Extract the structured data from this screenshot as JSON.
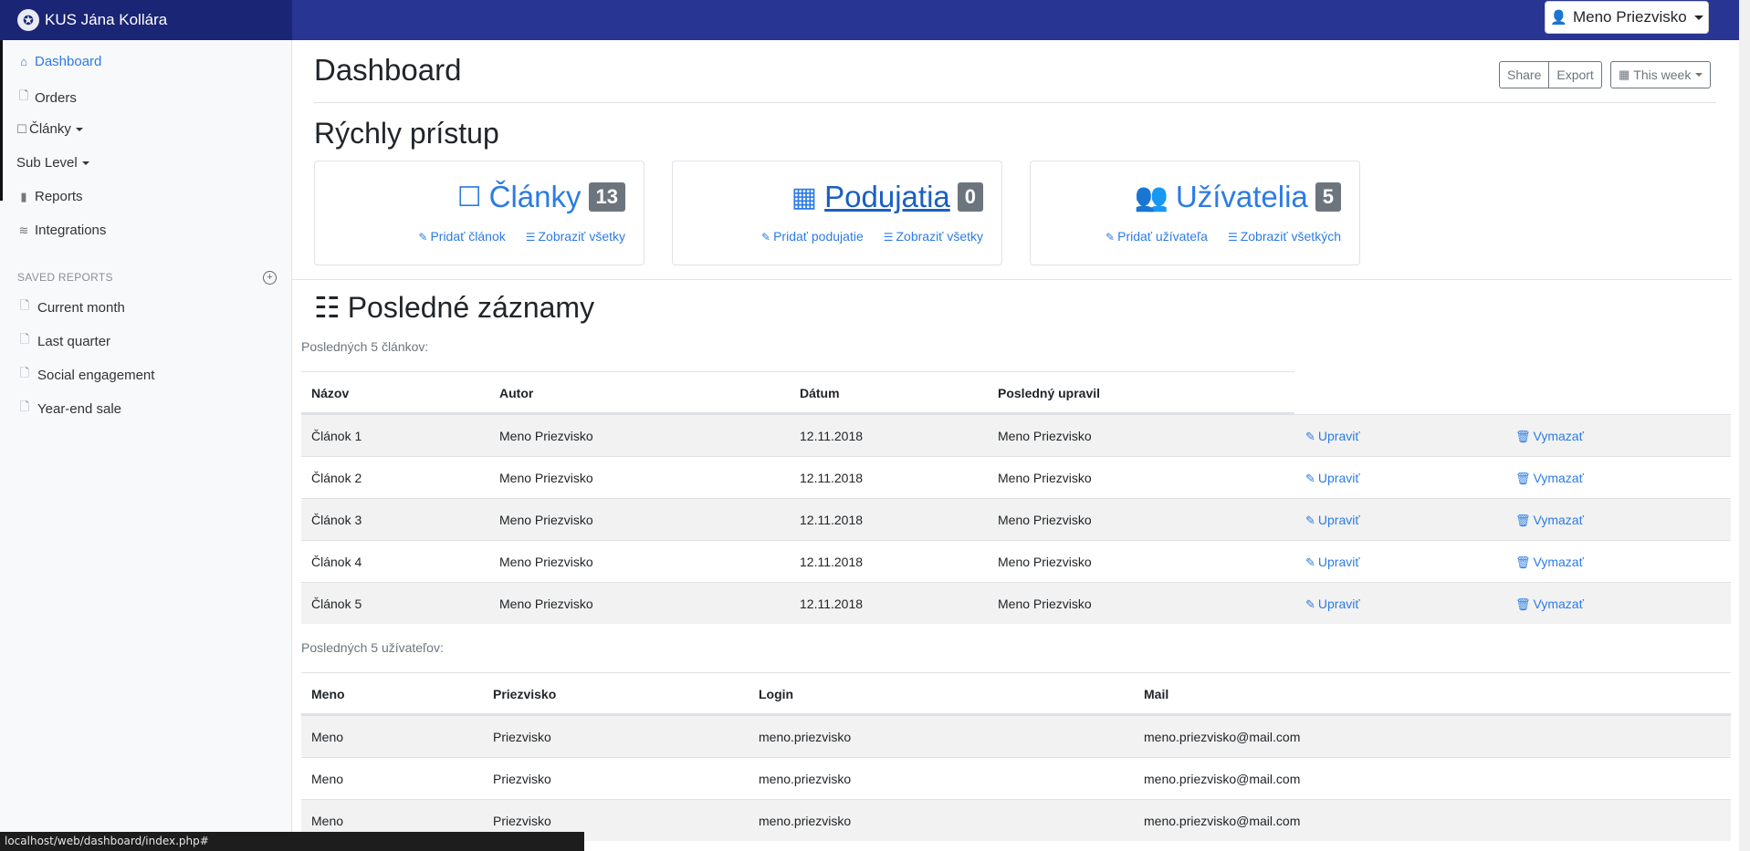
{
  "header": {
    "brand": "KUS Jána Kollára",
    "user_name": "Meno Priezvisko"
  },
  "sidebar": {
    "nav": [
      {
        "label": "Dashboard",
        "icon": "home-icon",
        "active": true
      },
      {
        "label": "Orders",
        "icon": "file-icon"
      },
      {
        "label": "Články",
        "icon": "note-icon",
        "dropdown": true
      },
      {
        "label": "Sub Level",
        "dropdown": true
      },
      {
        "label": "Reports",
        "icon": "bar-chart-icon"
      },
      {
        "label": "Integrations",
        "icon": "layers-icon"
      }
    ],
    "saved_reports_heading": "SAVED REPORTS",
    "saved_reports": [
      "Current month",
      "Last quarter",
      "Social engagement",
      "Year-end sale"
    ]
  },
  "main": {
    "title": "Dashboard",
    "share": "Share",
    "export": "Export",
    "period": "This week"
  },
  "quick_access": {
    "heading": "Rýchly prístup",
    "cards": [
      {
        "title": "Články",
        "count": "13",
        "add": "Pridať článok",
        "view": "Zobraziť všetky"
      },
      {
        "title": "Podujatia",
        "count": "0",
        "add": "Pridať podujatie",
        "view": "Zobraziť všetky"
      },
      {
        "title": "Užívatelia",
        "count": "5",
        "add": "Pridať užívateľa",
        "view": "Zobraziť všetkých"
      }
    ]
  },
  "recent": {
    "heading": "Posledné záznamy",
    "articles_caption": "Posledných 5 článkov:",
    "articles_columns": [
      "Názov",
      "Autor",
      "Dátum",
      "Posledný upravil"
    ],
    "edit_label": "Upraviť",
    "delete_label": "Vymazať",
    "articles": [
      {
        "title": "Článok 1",
        "author": "Meno Priezvisko",
        "date": "12.11.2018",
        "last_edit": "Meno Priezvisko"
      },
      {
        "title": "Článok 2",
        "author": "Meno Priezvisko",
        "date": "12.11.2018",
        "last_edit": "Meno Priezvisko"
      },
      {
        "title": "Článok 3",
        "author": "Meno Priezvisko",
        "date": "12.11.2018",
        "last_edit": "Meno Priezvisko"
      },
      {
        "title": "Článok 4",
        "author": "Meno Priezvisko",
        "date": "12.11.2018",
        "last_edit": "Meno Priezvisko"
      },
      {
        "title": "Článok 5",
        "author": "Meno Priezvisko",
        "date": "12.11.2018",
        "last_edit": "Meno Priezvisko"
      }
    ],
    "users_caption": "Posledných 5 užívateľov:",
    "users_columns": [
      "Meno",
      "Priezvisko",
      "Login",
      "Mail"
    ],
    "users": [
      {
        "first": "Meno",
        "last": "Priezvisko",
        "login": "meno.priezvisko",
        "mail": "meno.priezvisko@mail.com"
      },
      {
        "first": "Meno",
        "last": "Priezvisko",
        "login": "meno.priezvisko",
        "mail": "meno.priezvisko@mail.com"
      },
      {
        "first": "Meno",
        "last": "Priezvisko",
        "login": "meno.priezvisko",
        "mail": "meno.priezvisko@mail.com"
      }
    ]
  },
  "status_url": "localhost/web/dashboard/index.php#",
  "colors": {
    "topbar": "#283593",
    "brand_bg": "#1b2575",
    "link": "#2c7be5",
    "badge": "#6c757d"
  }
}
